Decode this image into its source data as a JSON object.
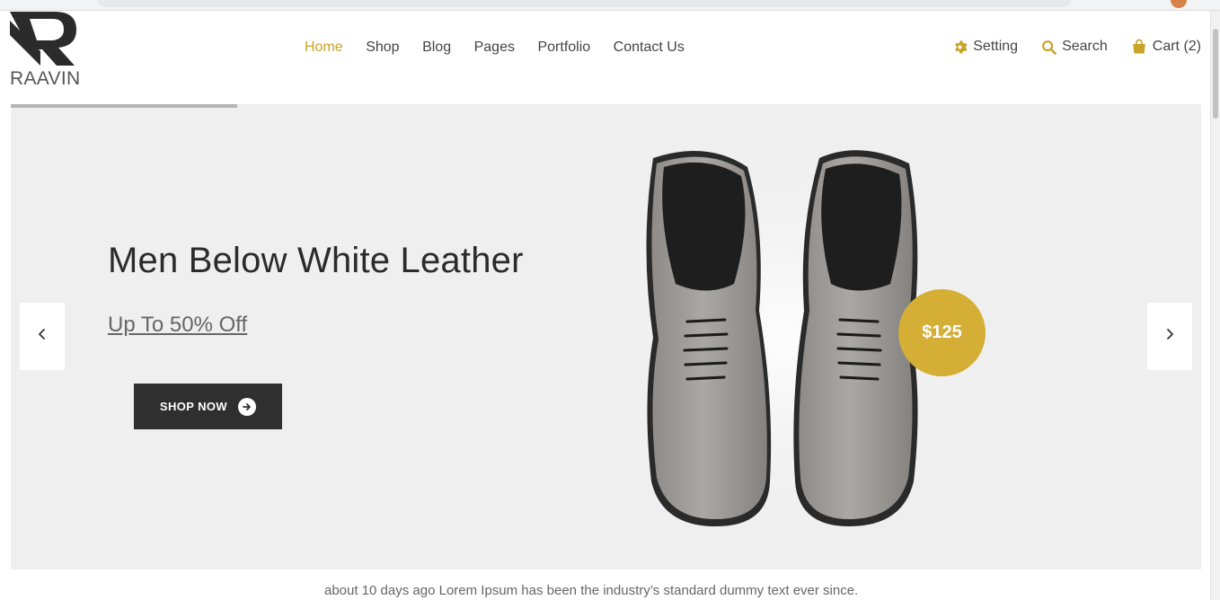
{
  "brand": {
    "name": "RAAVIN"
  },
  "nav": {
    "items": [
      {
        "label": "Home",
        "active": true
      },
      {
        "label": "Shop"
      },
      {
        "label": "Blog"
      },
      {
        "label": "Pages"
      },
      {
        "label": "Portfolio"
      },
      {
        "label": "Contact Us"
      }
    ]
  },
  "tools": {
    "setting": "Setting",
    "search": "Search",
    "cart": "Cart (2)"
  },
  "hero": {
    "title": "Men Below White Leather",
    "subtitle": "Up To 50% Off",
    "cta": "SHOP NOW",
    "price": "$125",
    "slide_progress": 0.19
  },
  "footer": {
    "note": "about 10 days ago Lorem Ipsum has been the industry’s standard dummy text ever since."
  },
  "colors": {
    "accent": "#c9a227",
    "badge": "#d4ae35",
    "hero_bg": "#efefef",
    "button_bg": "#2f2f2f"
  },
  "icons": [
    "gear-icon",
    "search-icon",
    "shopping-bag-icon",
    "arrow-right-circle-icon",
    "chevron-left-icon",
    "chevron-right-icon"
  ]
}
